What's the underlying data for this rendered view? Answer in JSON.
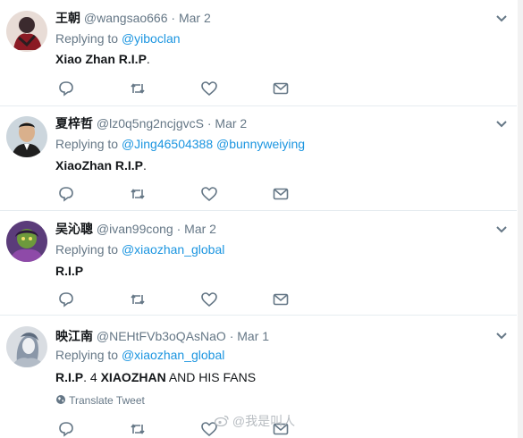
{
  "tweets": [
    {
      "name": "王朝",
      "handle": "@wangsao666",
      "separator": "·",
      "date": "Mar 2",
      "replying_prefix": "Replying to",
      "mentions": [
        "@yiboclan"
      ],
      "text": [
        {
          "t": "Xiao Zhan R.I.P",
          "bold": true
        },
        {
          "t": ".",
          "bold": false
        }
      ]
    },
    {
      "name": "夏梓哲",
      "handle": "@lz0q5ng2ncjgvcS",
      "separator": "·",
      "date": "Mar 2",
      "replying_prefix": "Replying to",
      "mentions": [
        "@Jing46504388",
        "@bunnyweiying"
      ],
      "text": [
        {
          "t": "XiaoZhan R.I.P",
          "bold": true
        },
        {
          "t": ".",
          "bold": false
        }
      ]
    },
    {
      "name": "吴沁聰",
      "handle": "@ivan99cong",
      "separator": "·",
      "date": "Mar 2",
      "replying_prefix": "Replying to",
      "mentions": [
        "@xiaozhan_global"
      ],
      "text": [
        {
          "t": "R.I.P",
          "bold": true
        }
      ]
    },
    {
      "name": "映江南",
      "handle": "@NEHtFVb3oQAsNaO",
      "separator": "·",
      "date": "Mar 1",
      "replying_prefix": "Replying to",
      "mentions": [
        "@xiaozhan_global"
      ],
      "text": [
        {
          "t": "R.I.P",
          "bold": true
        },
        {
          "t": ". 4 ",
          "bold": false
        },
        {
          "t": "XIAOZHAN",
          "bold": true
        },
        {
          "t": " AND HIS FANS",
          "bold": false
        }
      ],
      "translate_label": "Translate Tweet"
    }
  ],
  "icons": {
    "reply": "reply-icon",
    "retweet": "retweet-icon",
    "like": "like-icon",
    "dm": "dm-icon",
    "more": "chevron-down-icon",
    "globe": "globe-icon"
  },
  "watermark": "@我是叫人",
  "colors": {
    "mention": "#1b95e0",
    "secondary": "#657786",
    "primary": "#14171a",
    "divider": "#e6ecf0"
  }
}
